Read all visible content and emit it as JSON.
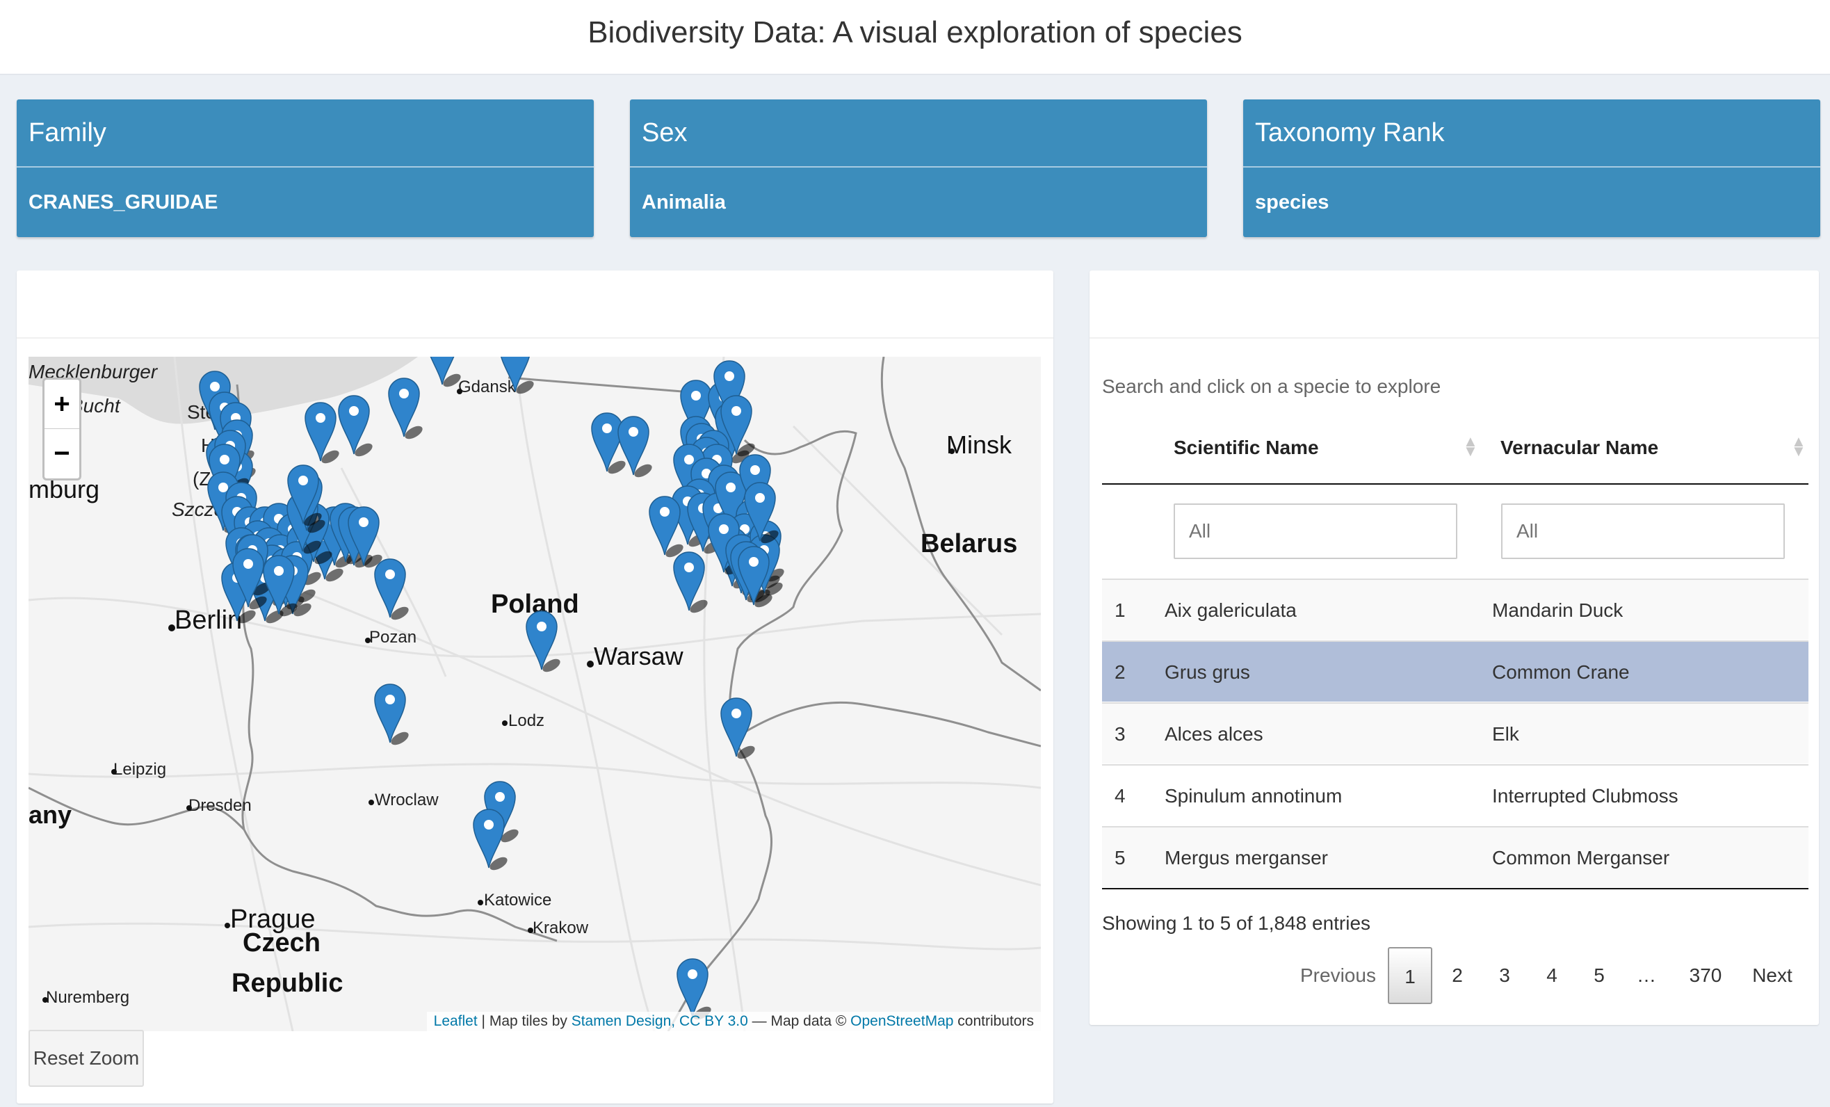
{
  "app": {
    "title": "Biodiversity Data: A visual exploration of species"
  },
  "value_boxes": [
    {
      "title": "Family",
      "value": "CRANES_GRUIDAE"
    },
    {
      "title": "Sex",
      "value": "Animalia"
    },
    {
      "title": "Taxonomy Rank",
      "value": "species"
    }
  ],
  "map": {
    "zoom_in": "+",
    "zoom_out": "−",
    "reset_label": "Reset Zoom",
    "attribution": {
      "leaflet": "Leaflet",
      "tiles_prefix": " | Map tiles by ",
      "stamen": "Stamen Design, CC BY 3.0",
      "data_prefix": " — Map data © ",
      "osm": "OpenStreetMap",
      "suffix": " contributors"
    },
    "labels": {
      "mecklenburger": "Mecklenburger",
      "bucht": "Bucht",
      "hamburg": "mburg",
      "stettin": "Ste",
      "haff": "Haff",
      "zalew": "(Za",
      "szczecin": "Szcze",
      "gdansk": "Gdansk",
      "minsk": "Minsk",
      "belarus": "Belarus",
      "berlin": "Berlin",
      "poland": "Poland",
      "poznan": "Pozan",
      "warsaw": "Warsaw",
      "lodz": "Lodz",
      "leipzig": "Leipzig",
      "dresden": "Dresden",
      "wroclaw": "Wroclaw",
      "germany": "any",
      "prague": "Prague",
      "czech": "Czech",
      "republic": "Republic",
      "katowice": "Katowice",
      "krakow": "Krakow",
      "nuremberg": "Nuremberg"
    },
    "marker_color": "#2f84cc"
  },
  "table": {
    "hint": "Search and click on a specie to explore",
    "columns": [
      "Scientific Name",
      "Vernacular Name"
    ],
    "filter_placeholder": "All",
    "rows": [
      {
        "n": "1",
        "scientific": "Aix galericulata",
        "vernacular": "Mandarin Duck"
      },
      {
        "n": "2",
        "scientific": "Grus grus",
        "vernacular": "Common Crane"
      },
      {
        "n": "3",
        "scientific": "Alces alces",
        "vernacular": "Elk"
      },
      {
        "n": "4",
        "scientific": "Spinulum annotinum",
        "vernacular": "Interrupted Clubmoss"
      },
      {
        "n": "5",
        "scientific": "Mergus merganser",
        "vernacular": "Common Merganser"
      }
    ],
    "info": "Showing 1 to 5 of 1,848 entries",
    "pagination": {
      "previous": "Previous",
      "pages": [
        "1",
        "2",
        "3",
        "4",
        "5",
        "…",
        "370"
      ],
      "next": "Next"
    }
  }
}
